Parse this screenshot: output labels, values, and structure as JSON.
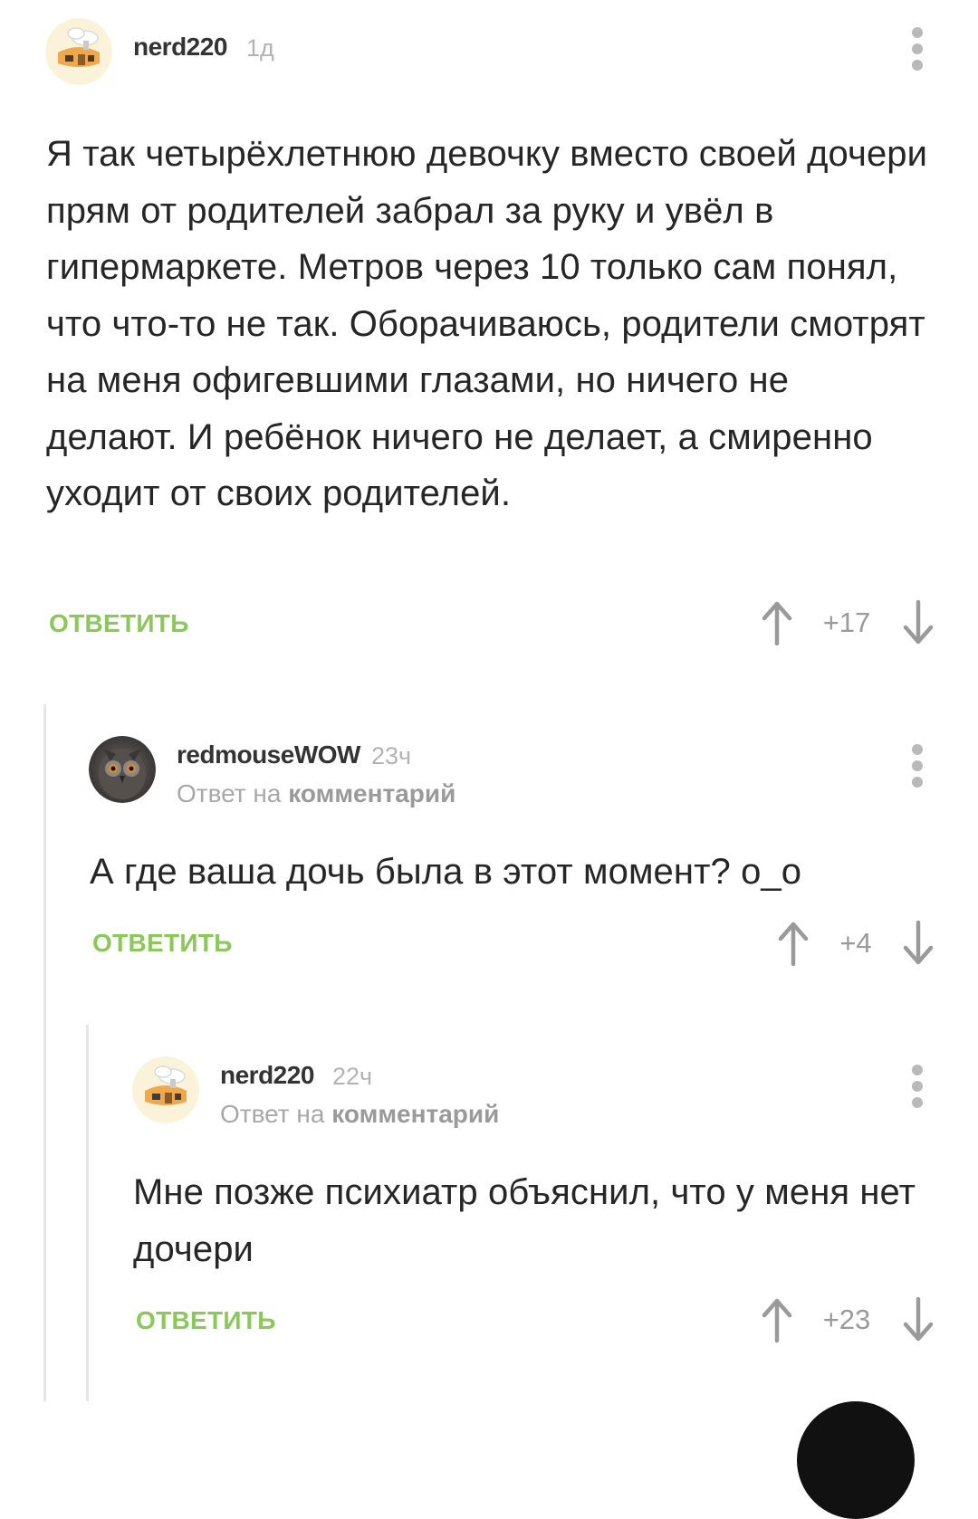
{
  "comments": [
    {
      "username": "nerd220",
      "time": "1д",
      "text": "Я так четырёхлетнюю девочку вместо своей дочери прям от родителей забрал за руку и увёл в гипермаркете. Метров через 10 только сам понял, что что-то не так. Оборачиваюсь, родители смотрят на меня офигевшими глазами, но ничего не делают. И ребёнок ничего не делает, а смиренно уходит от своих родителей.",
      "reply_label": "ОТВЕТИТЬ",
      "rating": "+17"
    },
    {
      "username": "redmouseWOW",
      "time": "23ч",
      "reply_to_prefix": "Ответ на",
      "reply_to_link": "комментарий",
      "text": "А где ваша дочь была в этот момент? о_о",
      "reply_label": "ОТВЕТИТЬ",
      "rating": "+4"
    },
    {
      "username": "nerd220",
      "time": "22ч",
      "reply_to_prefix": "Ответ на",
      "reply_to_link": "комментарий",
      "text": "Мне позже психиатр объяснил, что у меня нет дочери",
      "reply_label": "ОТВЕТИТЬ",
      "rating": "+23"
    }
  ],
  "colors": {
    "reply_green": "#8ac858",
    "meta_gray": "#b3b3b3",
    "thread_line": "#e6e6e6"
  },
  "icons": {
    "avatar_nerd": "house-cartoon-avatar",
    "avatar_redmouse": "owl-photo-avatar",
    "menu": "kebab-menu-icon",
    "upvote": "arrow-up-icon",
    "downvote": "arrow-down-icon"
  }
}
